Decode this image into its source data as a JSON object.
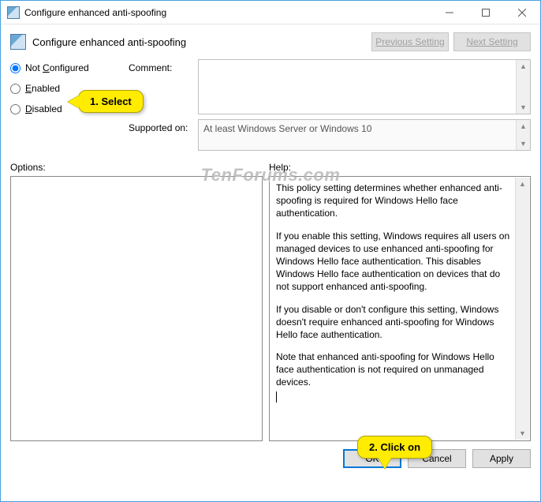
{
  "window": {
    "title": "Configure enhanced anti-spoofing"
  },
  "header": {
    "title": "Configure enhanced anti-spoofing",
    "prev": "Previous Setting",
    "next": "Next Setting"
  },
  "radios": {
    "not_configured": "Not Configured",
    "enabled": "Enabled",
    "disabled": "Disabled",
    "selected": "not_configured"
  },
  "labels": {
    "comment": "Comment:",
    "supported_on": "Supported on:",
    "options": "Options:",
    "help": "Help:"
  },
  "supported_on": "At least Windows Server or Windows 10",
  "help": {
    "p1": "This policy setting determines whether enhanced anti-spoofing is required for Windows Hello face authentication.",
    "p2": "If you enable this setting, Windows requires all users on managed devices to use enhanced anti-spoofing for Windows Hello face authentication. This disables Windows Hello face authentication on devices that do not support enhanced anti-spoofing.",
    "p3": "If you disable or don't configure this setting, Windows doesn't require enhanced anti-spoofing for Windows Hello face authentication.",
    "p4": "Note that enhanced anti-spoofing for Windows Hello face authentication is not required on unmanaged devices."
  },
  "buttons": {
    "ok": "OK",
    "cancel": "Cancel",
    "apply": "Apply"
  },
  "annotations": {
    "step1": "1. Select",
    "step2": "2. Click on"
  },
  "watermark": "TenForums.com"
}
